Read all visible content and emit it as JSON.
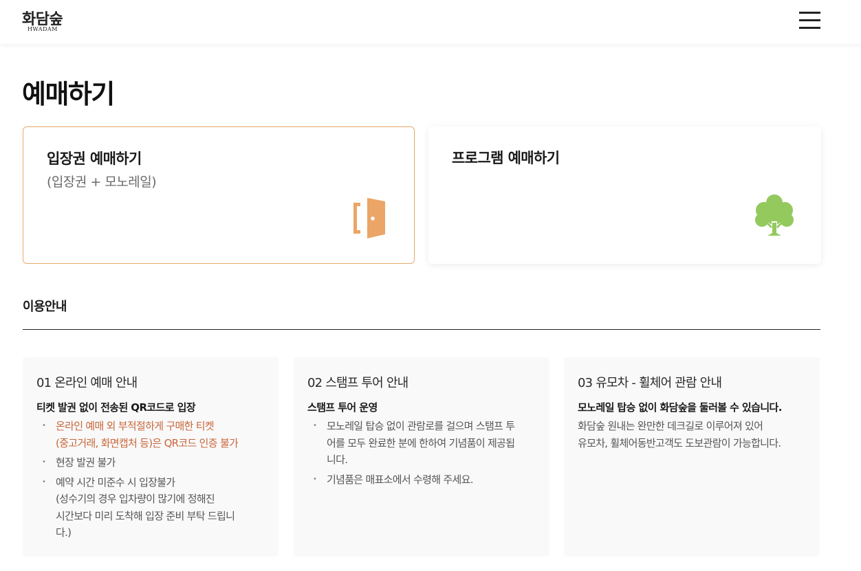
{
  "header": {
    "logo_ko": "화담숲",
    "logo_en": "HWADAM",
    "menu_icon": "hamburger-menu-icon"
  },
  "page": {
    "title": "예매하기"
  },
  "cards": {
    "entry": {
      "title": "입장권 예매하기",
      "subtitle": "(입장권 + 모노레일)",
      "icon": "door-icon",
      "accent": "#e8a868"
    },
    "program": {
      "title": "프로그램 예매하기",
      "icon": "tree-icon",
      "accent": "#94c95e"
    }
  },
  "guide": {
    "title": "이용안내",
    "boxes": [
      {
        "heading": "01 온라인 예매 안내",
        "subheading": "티켓 발권 없이 전송된 QR코드로 입장",
        "items": [
          {
            "lines": [
              "온라인 예매 외 부적절하게 구매한 티켓",
              "(중고거래, 화면캡처 등)은 QR코드 인증 불가"
            ],
            "warn": true
          },
          {
            "lines": [
              "현장 발권 불가"
            ],
            "warn": false
          },
          {
            "lines": [
              "예약 시간 미준수 시 입장불가",
              "(성수기의 경우 입차량이 많기에 정해진",
              "시간보다 미리 도착해 입장 준비 부탁 드립니",
              "다.)"
            ],
            "warn": false
          }
        ]
      },
      {
        "heading": "02 스탬프 투어 안내",
        "subheading": "스탬프 투어 운영",
        "items": [
          {
            "lines": [
              "모노레일 탑승 없이 관람로를 걸으며 스탬프 투",
              "어를 모두 완료한 분에 한하여 기념품이 제공됩",
              "니다."
            ],
            "warn": false
          },
          {
            "lines": [
              "기념품은 매표소에서 수령해 주세요."
            ],
            "warn": false
          }
        ]
      },
      {
        "heading": "03 유모차 - 휠체어 관람 안내",
        "subheading": "모노레일 탑승 없이 화담숲을 둘러볼 수 있습니다.",
        "text": [
          "화담숲 원내는 완만한 데크길로 이루어져 있어",
          "유모차, 휠체어동반고객도 도보관람이 가능합니다."
        ]
      }
    ]
  },
  "colors": {
    "warning_text": "#c8663a",
    "entry_border": "#e8a868",
    "door_icon": "#eba566",
    "tree_icon": "#94c95e"
  }
}
